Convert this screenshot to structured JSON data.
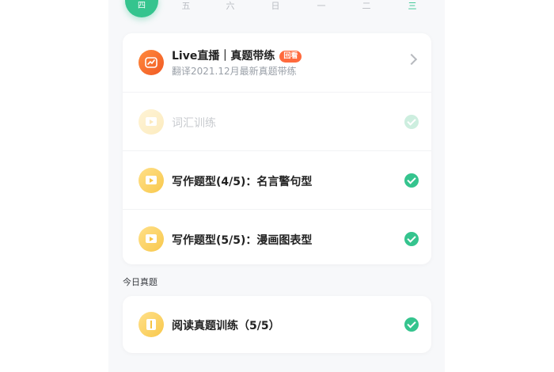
{
  "weekdays": [
    {
      "label": "四",
      "active": true
    },
    {
      "label": "五"
    },
    {
      "label": "六"
    },
    {
      "label": "日"
    },
    {
      "label": "一"
    },
    {
      "label": "二"
    },
    {
      "label": "三",
      "today": true
    }
  ],
  "live": {
    "title": "Live直播｜真题带练",
    "badge": "回看",
    "subtitle": "翻译2021.12月最新真题带练"
  },
  "tasks": [
    {
      "label": "词汇训练",
      "faded": true
    },
    {
      "label": "写作题型(4/5)：名言警句型"
    },
    {
      "label": "写作题型(5/5)：漫画图表型"
    }
  ],
  "section": {
    "label": "今日真题"
  },
  "today": {
    "label": "阅读真题训练（5/5）"
  },
  "colors": {
    "accent": "#35c48e",
    "live": "#f15a24",
    "badge": "#ff6a3d",
    "task_icon": "#f8c84b"
  }
}
